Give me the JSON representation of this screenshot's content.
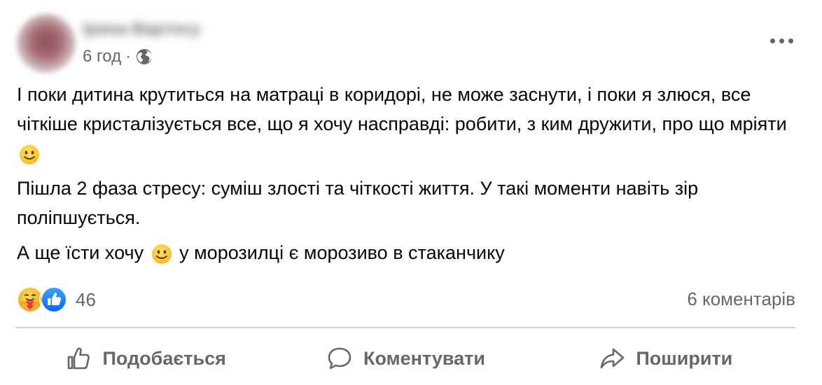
{
  "post": {
    "author_name": "Ірина Вартосу",
    "timestamp": "6 год",
    "separator": "·",
    "audience_icon": "globe-icon",
    "menu_icon": "more-horizontal-icon",
    "paragraph1_a": "І поки дитина крутиться на матраці в коридорі, не може заснути, і поки я злюся, все чіткіше кристалізується все, що я хочу насправді: робити, з ким дружити, про що мріяти",
    "paragraph2": "Пішла 2 фаза стресу: суміш злості та чіткості життя. У такі моменти навіть зір поліпшується.",
    "paragraph3_a": "А ще їсти хочу",
    "paragraph3_b": "у морозилці є морозиво в стаканчику",
    "emoji": "smiling-face-emoji"
  },
  "stats": {
    "reaction_icons": [
      "care-reaction-icon",
      "like-reaction-icon"
    ],
    "reaction_count": "46",
    "comments_label": "6 коментарів"
  },
  "actions": {
    "like_label": "Подобається",
    "comment_label": "Коментувати",
    "share_label": "Поширити"
  },
  "colors": {
    "text": "#050505",
    "secondary_text": "#65676b",
    "like_blue": "#1877f2",
    "care_yellow": "#f7b928",
    "divider": "#ced0d4"
  }
}
